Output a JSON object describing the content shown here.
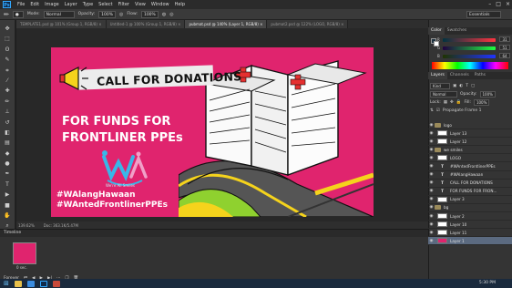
{
  "app": {
    "logo": "Ps",
    "menu": [
      "File",
      "Edit",
      "Image",
      "Layer",
      "Type",
      "Select",
      "Filter",
      "View",
      "Window",
      "Help"
    ],
    "window_controls": [
      "–",
      "□",
      "×"
    ]
  },
  "options": {
    "mode_label": "Mode:",
    "mode_value": "Normal",
    "opacity_label": "Opacity:",
    "opacity_value": "100%",
    "flow_label": "Flow:",
    "flow_value": "100%",
    "workspace": "Essentials"
  },
  "tabs": [
    {
      "label": "TEMPLATE1.psd @ 101% (Group 1, RGB/8) ×",
      "active": false
    },
    {
      "label": "Untitled-1 @ 100% (Group 1, RGB/8) ×",
      "active": false
    },
    {
      "label": "pubmat.psd @ 140% (Layer 1, RGB/8) ×",
      "active": true
    },
    {
      "label": "pubmat2.psd @ 122% (LOGO, RGB/8) ×",
      "active": false
    }
  ],
  "toolbar": {
    "tools": [
      {
        "name": "move-tool-icon",
        "glyph": "✥"
      },
      {
        "name": "marquee-tool-icon",
        "glyph": "⬚"
      },
      {
        "name": "lasso-tool-icon",
        "glyph": "ʘ"
      },
      {
        "name": "quick-select-tool-icon",
        "glyph": "✎"
      },
      {
        "name": "crop-tool-icon",
        "glyph": "⌗"
      },
      {
        "name": "eyedropper-tool-icon",
        "glyph": "⁄"
      },
      {
        "name": "healing-tool-icon",
        "glyph": "✚"
      },
      {
        "name": "brush-tool-icon",
        "glyph": "✏"
      },
      {
        "name": "clone-stamp-tool-icon",
        "glyph": "⊥"
      },
      {
        "name": "history-brush-tool-icon",
        "glyph": "↺"
      },
      {
        "name": "eraser-tool-icon",
        "glyph": "◧"
      },
      {
        "name": "gradient-tool-icon",
        "glyph": "▤"
      },
      {
        "name": "blur-tool-icon",
        "glyph": "◆"
      },
      {
        "name": "dodge-tool-icon",
        "glyph": "●"
      },
      {
        "name": "pen-tool-icon",
        "glyph": "✒"
      },
      {
        "name": "type-tool-icon",
        "glyph": "T"
      },
      {
        "name": "path-select-tool-icon",
        "glyph": "▶"
      },
      {
        "name": "shape-tool-icon",
        "glyph": "■"
      },
      {
        "name": "hand-tool-icon",
        "glyph": "✋"
      },
      {
        "name": "zoom-tool-icon",
        "glyph": "⌕"
      }
    ]
  },
  "artwork": {
    "banner_text": "CALL FOR DONATIONS",
    "funds_line1": "FOR FUNDS FOR",
    "funds_line2": "FRONTLINER PPEs",
    "logo_tagline": "We're All Smiles",
    "hashtag1": "#WAlangHawaan",
    "hashtag2": "#WAntedFrontlinerPPEs"
  },
  "status": {
    "zoom": "139.62%",
    "doc": "Doc: 363.1K/5.47M"
  },
  "timeline": {
    "title": "Timeline",
    "frame_time": "0 sec.",
    "loop": "Forever"
  },
  "color_panel": {
    "tabs": [
      "Color",
      "Swatches"
    ],
    "rows": [
      {
        "label": "R",
        "value": "31"
      },
      {
        "label": "G",
        "value": "51"
      },
      {
        "label": "B",
        "value": "64"
      }
    ]
  },
  "layers_panel": {
    "tabs": [
      "Layers",
      "Channels",
      "Paths"
    ],
    "kind_label": "Kind",
    "blend_mode": "Normal",
    "opacity_label": "Opacity:",
    "opacity_value": "100%",
    "lock_label": "Lock:",
    "fill_label": "Fill:",
    "fill_value": "100%",
    "propagate_label": "Propagate Frame 1",
    "layers": [
      {
        "name": "logo",
        "type": "folder",
        "selected": false
      },
      {
        "name": "Layer 13",
        "type": "pixel",
        "selected": false
      },
      {
        "name": "Layer 12",
        "type": "pixel",
        "selected": false
      },
      {
        "name": "we smiles",
        "type": "folder",
        "selected": false
      },
      {
        "name": "LOGO",
        "type": "pixel",
        "selected": false
      },
      {
        "name": "#WAntedFrontlinerPPEs",
        "type": "text",
        "selected": false
      },
      {
        "name": "#WAlangHawaan",
        "type": "text",
        "selected": false
      },
      {
        "name": "CALL FOR DONATIONS",
        "type": "text",
        "selected": false
      },
      {
        "name": "FOR FUNDS FOR FRON...",
        "type": "text",
        "selected": false
      },
      {
        "name": "Layer 3",
        "type": "pixel",
        "selected": false
      },
      {
        "name": "bg",
        "type": "folder",
        "selected": false
      },
      {
        "name": "Layer 2",
        "type": "pixel",
        "selected": false
      },
      {
        "name": "Layer 10",
        "type": "pixel",
        "selected": false
      },
      {
        "name": "Layer 11",
        "type": "pixel",
        "selected": false
      },
      {
        "name": "Layer 1",
        "type": "pink",
        "selected": true
      }
    ]
  },
  "taskbar": {
    "time": "5:30 PM"
  }
}
